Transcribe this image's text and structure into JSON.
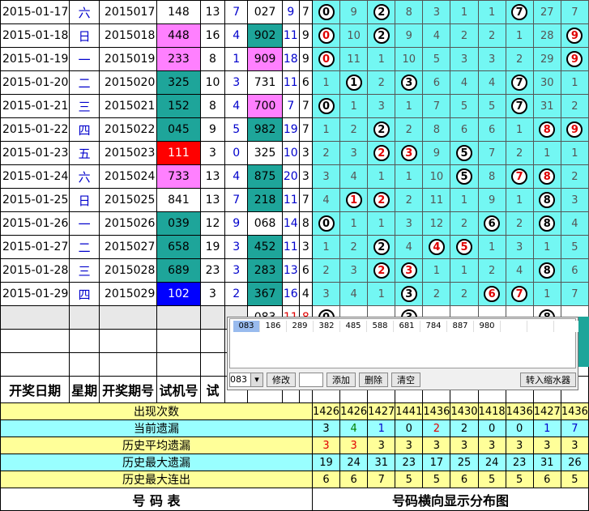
{
  "rows": [
    {
      "date": "2015-01-17",
      "wk": "六",
      "period": "2015017",
      "test": "148",
      "test_hl": "",
      "c1": "13",
      "c2": "7",
      "draw": "027",
      "draw_hl": "",
      "sum": "9",
      "span": "7",
      "cells": [
        "B0",
        "9",
        "B2",
        "8",
        "3",
        "1",
        "1",
        "B7",
        "27",
        "7"
      ]
    },
    {
      "date": "2015-01-18",
      "wk": "日",
      "period": "2015018",
      "test": "448",
      "test_hl": "pink",
      "c1": "16",
      "c2": "4",
      "draw": "902",
      "draw_hl": "teal",
      "sum": "11",
      "span": "9",
      "cells": [
        "R0",
        "10",
        "B2",
        "9",
        "4",
        "2",
        "2",
        "1",
        "28",
        "R9"
      ]
    },
    {
      "date": "2015-01-19",
      "wk": "一",
      "period": "2015019",
      "test": "233",
      "test_hl": "pink",
      "c1": "8",
      "c2": "1",
      "draw": "909",
      "draw_hl": "pink",
      "sum": "18",
      "span": "9",
      "cells": [
        "R0",
        "11",
        "1",
        "10",
        "5",
        "3",
        "3",
        "2",
        "29",
        "R9"
      ]
    },
    {
      "date": "2015-01-20",
      "wk": "二",
      "period": "2015020",
      "test": "325",
      "test_hl": "teal",
      "c1": "10",
      "c2": "3",
      "draw": "731",
      "draw_hl": "",
      "sum": "11",
      "span": "6",
      "cells": [
        "1",
        "B1",
        "2",
        "B3",
        "6",
        "4",
        "4",
        "B7",
        "30",
        "1"
      ]
    },
    {
      "date": "2015-01-21",
      "wk": "三",
      "period": "2015021",
      "test": "152",
      "test_hl": "teal",
      "c1": "8",
      "c2": "4",
      "draw": "700",
      "draw_hl": "pink",
      "sum": "7",
      "span": "7",
      "cells": [
        "B0",
        "1",
        "3",
        "1",
        "7",
        "5",
        "5",
        "B7",
        "31",
        "2"
      ]
    },
    {
      "date": "2015-01-22",
      "wk": "四",
      "period": "2015022",
      "test": "045",
      "test_hl": "teal",
      "c1": "9",
      "c2": "5",
      "draw": "982",
      "draw_hl": "teal",
      "sum": "19",
      "span": "7",
      "cells": [
        "1",
        "2",
        "B2",
        "2",
        "8",
        "6",
        "6",
        "1",
        "R8",
        "R9"
      ]
    },
    {
      "date": "2015-01-23",
      "wk": "五",
      "period": "2015023",
      "test": "111",
      "test_hl": "red",
      "c1": "3",
      "c2": "0",
      "draw": "325",
      "draw_hl": "",
      "sum": "10",
      "span": "3",
      "cells": [
        "2",
        "3",
        "R2",
        "R3",
        "9",
        "B5",
        "7",
        "2",
        "1",
        "1"
      ]
    },
    {
      "date": "2015-01-24",
      "wk": "六",
      "period": "2015024",
      "test": "733",
      "test_hl": "pink",
      "c1": "13",
      "c2": "4",
      "draw": "875",
      "draw_hl": "teal",
      "sum": "20",
      "span": "3",
      "cells": [
        "3",
        "4",
        "1",
        "1",
        "10",
        "B5",
        "8",
        "R7",
        "R8",
        "2"
      ]
    },
    {
      "date": "2015-01-25",
      "wk": "日",
      "period": "2015025",
      "test": "841",
      "test_hl": "",
      "c1": "13",
      "c2": "7",
      "draw": "218",
      "draw_hl": "teal",
      "sum": "11",
      "span": "7",
      "cells": [
        "4",
        "R1",
        "R2",
        "2",
        "11",
        "1",
        "9",
        "1",
        "B8",
        "3"
      ]
    },
    {
      "date": "2015-01-26",
      "wk": "一",
      "period": "2015026",
      "test": "039",
      "test_hl": "teal",
      "c1": "12",
      "c2": "9",
      "draw": "068",
      "draw_hl": "",
      "sum": "14",
      "span": "8",
      "cells": [
        "B0",
        "1",
        "1",
        "3",
        "12",
        "2",
        "B6",
        "2",
        "B8",
        "4"
      ]
    },
    {
      "date": "2015-01-27",
      "wk": "二",
      "period": "2015027",
      "test": "658",
      "test_hl": "teal",
      "c1": "19",
      "c2": "3",
      "draw": "452",
      "draw_hl": "teal",
      "sum": "11",
      "span": "3",
      "cells": [
        "1",
        "2",
        "B2",
        "4",
        "R4",
        "R5",
        "1",
        "3",
        "1",
        "5"
      ]
    },
    {
      "date": "2015-01-28",
      "wk": "三",
      "period": "2015028",
      "test": "689",
      "test_hl": "teal",
      "c1": "23",
      "c2": "3",
      "draw": "283",
      "draw_hl": "teal",
      "sum": "13",
      "span": "6",
      "cells": [
        "2",
        "3",
        "R2",
        "R3",
        "1",
        "1",
        "2",
        "4",
        "B8",
        "6"
      ]
    },
    {
      "date": "2015-01-29",
      "wk": "四",
      "period": "2015029",
      "test": "102",
      "test_hl": "blue",
      "c1": "3",
      "c2": "2",
      "draw": "367",
      "draw_hl": "teal",
      "sum": "16",
      "span": "4",
      "cells": [
        "3",
        "4",
        "1",
        "B3",
        "2",
        "2",
        "R6",
        "R7",
        "1",
        "7"
      ]
    }
  ],
  "predict": {
    "draw": "083",
    "sum": "11",
    "span": "8",
    "cells": [
      "B0",
      "",
      "",
      "B3",
      "",
      "",
      "",
      "",
      "B8",
      ""
    ]
  },
  "header": [
    "开奖日期",
    "星期",
    "开奖期号",
    "试机号",
    "试"
  ],
  "stats": [
    {
      "label": "出现次数",
      "vals": [
        "1426",
        "1426",
        "1427",
        "1441",
        "1436",
        "1430",
        "1418",
        "1436",
        "1427",
        "1436"
      ],
      "colors": []
    },
    {
      "label": "当前遗漏",
      "vals": [
        "3",
        "4",
        "1",
        "0",
        "2",
        "2",
        "0",
        "0",
        "1",
        "7"
      ],
      "colors": [
        "",
        "g",
        "bl",
        "",
        "rd",
        "",
        "",
        "",
        "bl",
        "bl"
      ]
    },
    {
      "label": "历史平均遗漏",
      "vals": [
        "3",
        "3",
        "3",
        "3",
        "3",
        "3",
        "3",
        "3",
        "3",
        "3"
      ],
      "colors": [
        "rd",
        "rd",
        "",
        "",
        "",
        "",
        "",
        "",
        "",
        ""
      ]
    },
    {
      "label": "历史最大遗漏",
      "vals": [
        "19",
        "24",
        "31",
        "23",
        "17",
        "25",
        "24",
        "23",
        "31",
        "26"
      ],
      "colors": []
    },
    {
      "label": "历史最大连出",
      "vals": [
        "6",
        "6",
        "7",
        "5",
        "5",
        "6",
        "5",
        "5",
        "6",
        "5"
      ],
      "colors": []
    }
  ],
  "footer": {
    "left": "号    码    表",
    "right": "号码横向显示分布图"
  },
  "popup": {
    "tokens": [
      "083",
      "186",
      "289",
      "382",
      "485",
      "588",
      "681",
      "784",
      "887",
      "980"
    ],
    "select_value": "083",
    "btn_modify": "修改",
    "btn_add": "添加",
    "btn_delete": "删除",
    "btn_clear": "清空",
    "btn_shrink": "转入缩水器"
  }
}
